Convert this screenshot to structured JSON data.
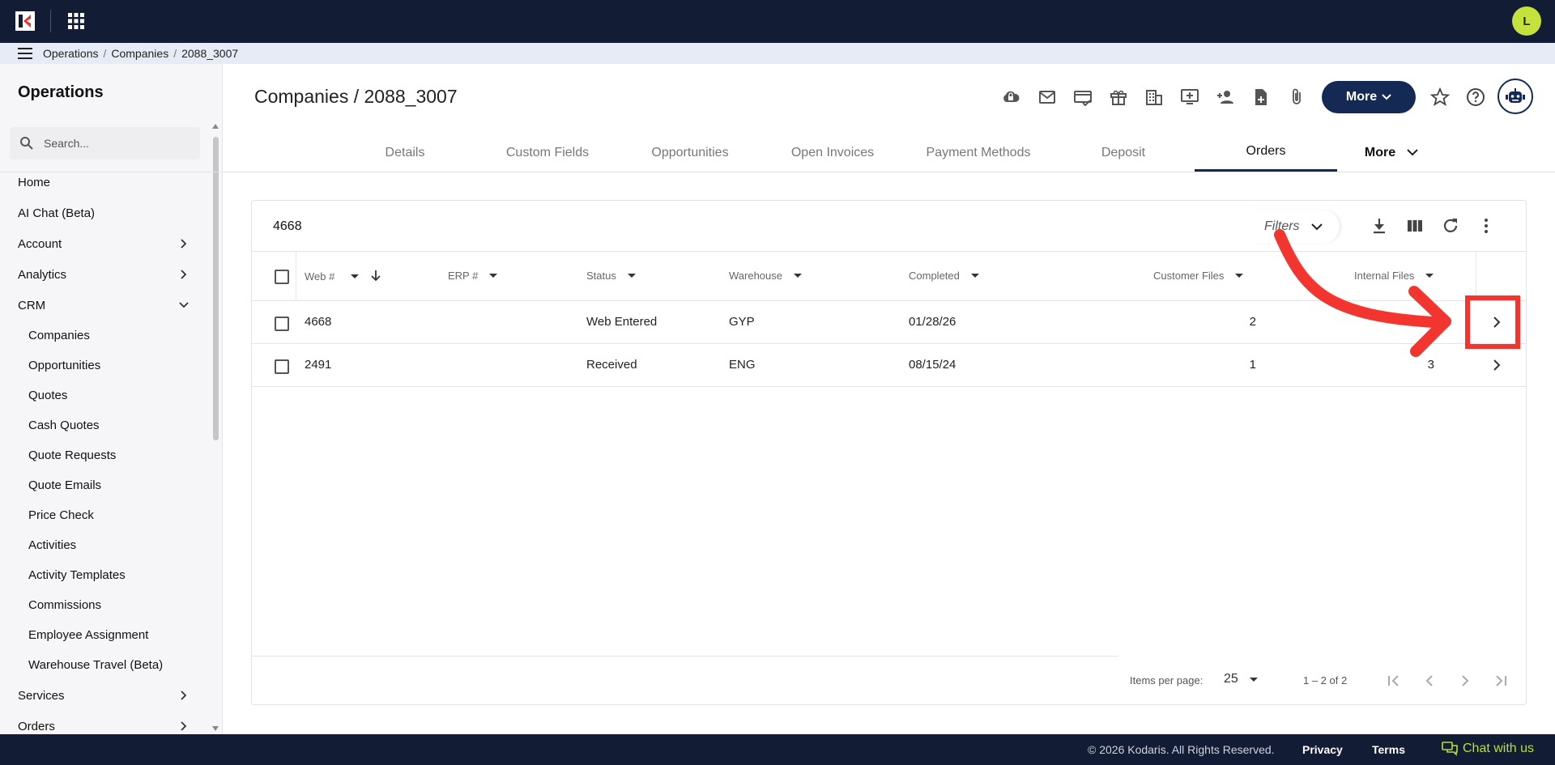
{
  "topbar": {
    "avatar_initial": "L"
  },
  "breadcrumb": [
    "Operations",
    "Companies",
    "2088_3007"
  ],
  "sidebar": {
    "title": "Operations",
    "search_placeholder": "Search...",
    "items": [
      {
        "label": "Home"
      },
      {
        "label": "AI Chat (Beta)"
      },
      {
        "label": "Account",
        "expandable": true
      },
      {
        "label": "Analytics",
        "expandable": true
      },
      {
        "label": "CRM",
        "expanded": true
      },
      {
        "label": "Companies",
        "sub": true
      },
      {
        "label": "Opportunities",
        "sub": true
      },
      {
        "label": "Quotes",
        "sub": true
      },
      {
        "label": "Cash Quotes",
        "sub": true
      },
      {
        "label": "Quote Requests",
        "sub": true
      },
      {
        "label": "Quote Emails",
        "sub": true
      },
      {
        "label": "Price Check",
        "sub": true
      },
      {
        "label": "Activities",
        "sub": true
      },
      {
        "label": "Activity Templates",
        "sub": true
      },
      {
        "label": "Commissions",
        "sub": true
      },
      {
        "label": "Employee Assignment",
        "sub": true
      },
      {
        "label": "Warehouse Travel (Beta)",
        "sub": true
      },
      {
        "label": "Services",
        "expandable": true
      },
      {
        "label": "Orders",
        "expandable": true
      }
    ]
  },
  "page": {
    "title": "Companies / 2088_3007",
    "more_button": "More",
    "toolbar_icons": [
      "cloud-lock-icon",
      "mail-icon",
      "card-check-icon",
      "gift-icon",
      "building-icon",
      "monitor-add-icon",
      "person-add-icon",
      "file-add-icon",
      "attachment-icon"
    ]
  },
  "tabs": [
    {
      "label": "Details"
    },
    {
      "label": "Custom Fields"
    },
    {
      "label": "Opportunities"
    },
    {
      "label": "Open Invoices"
    },
    {
      "label": "Payment Methods"
    },
    {
      "label": "Deposit"
    },
    {
      "label": "Orders",
      "active": true
    },
    {
      "label": "More"
    }
  ],
  "table": {
    "filter_value": "4668",
    "filters_label": "Filters",
    "columns": [
      "Web #",
      "ERP #",
      "Status",
      "Warehouse",
      "Completed",
      "Customer Files",
      "Internal Files"
    ],
    "rows": [
      {
        "web": "4668",
        "erp": "",
        "status": "Web Entered",
        "warehouse": "GYP",
        "completed": "01/28/26",
        "customer_files": "2",
        "internal_files": ""
      },
      {
        "web": "2491",
        "erp": "",
        "status": "Received",
        "warehouse": "ENG",
        "completed": "08/15/24",
        "customer_files": "1",
        "internal_files": "3"
      }
    ],
    "items_per_page_label": "Items per page:",
    "items_per_page": "25",
    "range_label": "1 – 2 of 2"
  },
  "footer": {
    "copyright": "© 2026 Kodaris. All Rights Reserved.",
    "privacy": "Privacy",
    "terms": "Terms",
    "chat": "Chat with us"
  },
  "colors": {
    "navy": "#121c35",
    "accent": "#142a55",
    "avatar": "#c4e23b",
    "annotation": "#f2352e"
  }
}
